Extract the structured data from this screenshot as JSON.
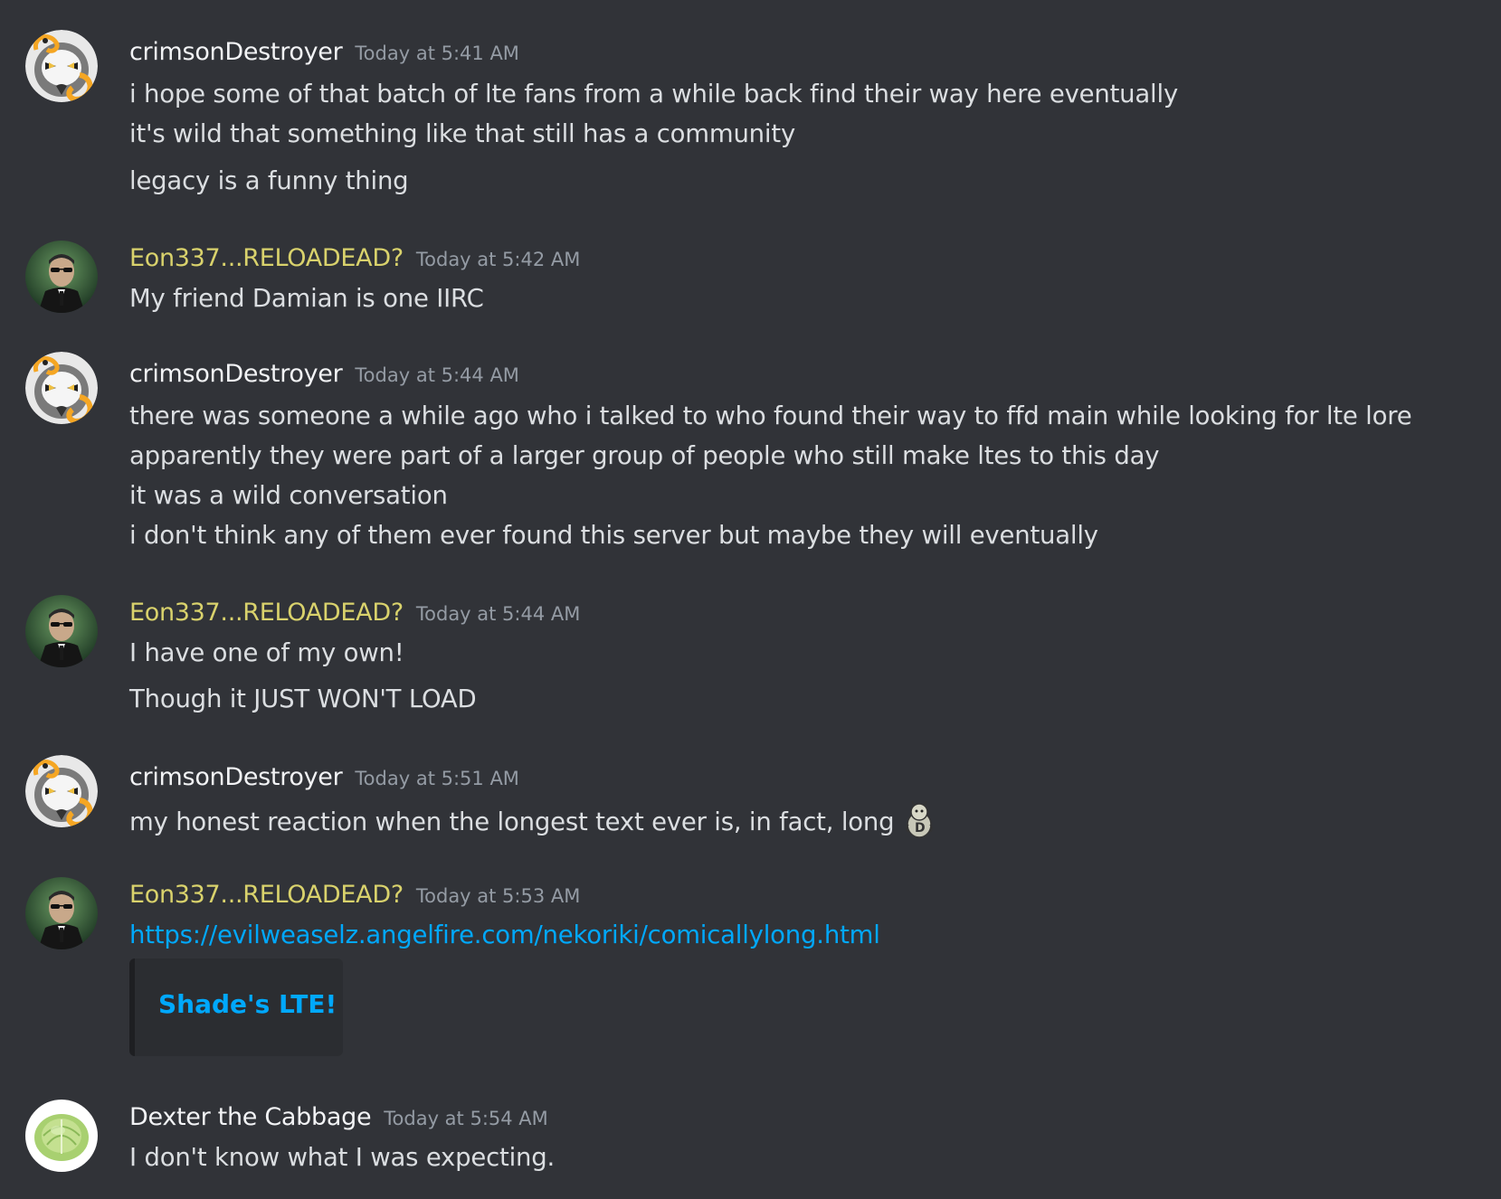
{
  "messages": [
    {
      "username": "crimsonDestroyer",
      "timestamp": "Today at 5:41 AM",
      "avatar_icon": "crimson-avatar",
      "lines": [
        "i hope some of that batch of lte fans from a while back find their way here eventually",
        "it's wild that something like that still has a community",
        "legacy is a funny thing"
      ]
    },
    {
      "username": "Eon337...RELOADEAD?",
      "timestamp": "Today at 5:42 AM",
      "avatar_icon": "eon-avatar",
      "lines": [
        "My friend Damian is one IIRC"
      ]
    },
    {
      "username": "crimsonDestroyer",
      "timestamp": "Today at 5:44 AM",
      "avatar_icon": "crimson-avatar",
      "lines": [
        "there was someone a while ago who i talked to who found their way to ffd main while looking for lte lore",
        "apparently they were part of a larger group of people who still make ltes to this day",
        "it was a wild conversation",
        "i don't think any of them ever found this server but maybe they will eventually"
      ]
    },
    {
      "username": "Eon337...RELOADEAD?",
      "timestamp": "Today at 5:44 AM",
      "avatar_icon": "eon-avatar",
      "lines": [
        "I have one of my own!",
        "Though it JUST WON'T LOAD"
      ]
    },
    {
      "username": "crimsonDestroyer",
      "timestamp": "Today at 5:51 AM",
      "avatar_icon": "crimson-avatar",
      "lines": [
        "my honest reaction when the longest text ever is, in fact, long"
      ],
      "emoji_icon": "custom-emoji"
    },
    {
      "username": "Eon337...RELOADEAD?",
      "timestamp": "Today at 5:53 AM",
      "avatar_icon": "eon-avatar",
      "link": "https://evilweaselz.angelfire.com/nekoriki/comicallylong.html",
      "embed_title": "Shade's LTE!"
    },
    {
      "username": "Dexter the Cabbage",
      "timestamp": "Today at 5:54 AM",
      "avatar_icon": "cabbage-avatar",
      "lines": [
        "I don't know what I was expecting."
      ]
    }
  ],
  "colors": {
    "background": "#313338",
    "username_default": "#f2f3f5",
    "username_eon": "#d9d26c",
    "timestamp": "#949ba4",
    "text": "#dbdee1",
    "link": "#00a8fc"
  }
}
